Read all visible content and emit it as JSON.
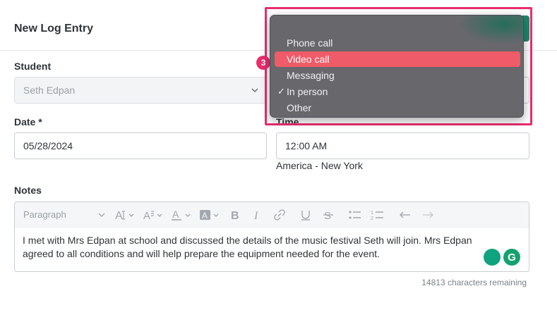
{
  "header": {
    "title": "New Log Entry"
  },
  "student": {
    "label": "Student",
    "value": "Seth Edpan"
  },
  "date": {
    "label": "Date *",
    "value": "05/28/2024"
  },
  "time": {
    "label": "Time",
    "value": "12:00 AM",
    "timezone": "America - New York"
  },
  "notes": {
    "label": "Notes",
    "toolbar": {
      "paragraph": "Paragraph",
      "items": [
        "font-size-icon",
        "line-height-icon",
        "font-color-icon",
        "highlight-color-icon",
        "bold-icon",
        "italic-icon",
        "link-icon",
        "underline-icon",
        "strikethrough-icon",
        "bullet-list-icon",
        "numbered-list-icon",
        "undo-icon",
        "redo-icon"
      ]
    },
    "text": "I met with Mrs Edpan at school and discussed the details of the music festival Seth will join. Mrs Edpan agreed to all conditions and will help prepare the equipment needed for the event.",
    "chars_remaining": "14813 characters remaining"
  },
  "contact_method_menu": {
    "options": [
      {
        "label": "Phone call",
        "highlighted": false,
        "checked": false
      },
      {
        "label": "Video call",
        "highlighted": true,
        "checked": false
      },
      {
        "label": "Messaging",
        "highlighted": false,
        "checked": false
      },
      {
        "label": "In person",
        "highlighted": false,
        "checked": true
      },
      {
        "label": "Other",
        "highlighted": false,
        "checked": false
      }
    ],
    "check_mark": "✓"
  },
  "annotation": {
    "step": "3"
  },
  "colors": {
    "highlight": "#ea2d6f",
    "menu_bg": "#67676c",
    "menu_active": "#ef5b68",
    "grammarly": "#15a16f"
  }
}
